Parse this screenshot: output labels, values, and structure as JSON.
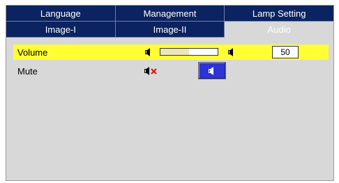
{
  "tabs_row1": [
    {
      "label": "Language"
    },
    {
      "label": "Management"
    },
    {
      "label": "Lamp Setting"
    }
  ],
  "tabs_row2": [
    {
      "label": "Image-I"
    },
    {
      "label": "Image-II"
    },
    {
      "label": "Audio",
      "active": true
    }
  ],
  "volume": {
    "label": "Volume",
    "value": "50",
    "level": 0.5
  },
  "mute": {
    "label": "Mute",
    "off_icon": "speaker-muted-icon",
    "on_icon": "speaker-icon"
  },
  "colors": {
    "tab_bg": "#0b2360",
    "highlight": "#ffff33",
    "panel": "#d8d8d8",
    "button": "#2e33d6"
  }
}
